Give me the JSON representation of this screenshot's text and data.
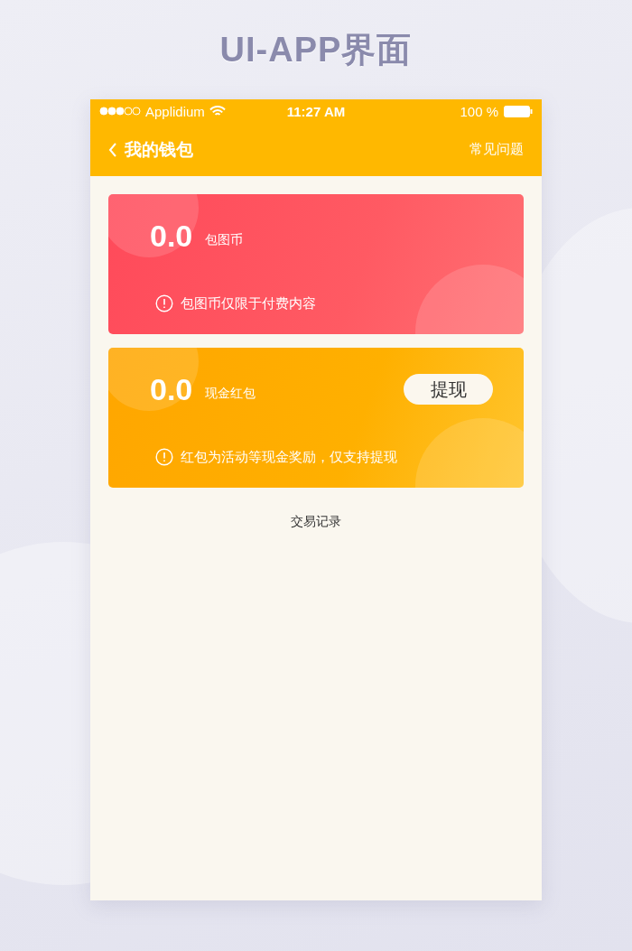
{
  "headline": "UI-APP界面",
  "status_bar": {
    "carrier": "Applidium",
    "time": "11:27 AM",
    "battery": "100 %"
  },
  "nav": {
    "title": "我的钱包",
    "action": "常见问题"
  },
  "cards": [
    {
      "kind": "coin",
      "amount": "0.0",
      "label": "包图币",
      "note": "包图币仅限于付费内容"
    },
    {
      "kind": "cash",
      "amount": "0.0",
      "label": "现金红包",
      "button": "提现",
      "note": "红包为活动等现金奖励，仅支持提现"
    }
  ],
  "link": "交易记录"
}
